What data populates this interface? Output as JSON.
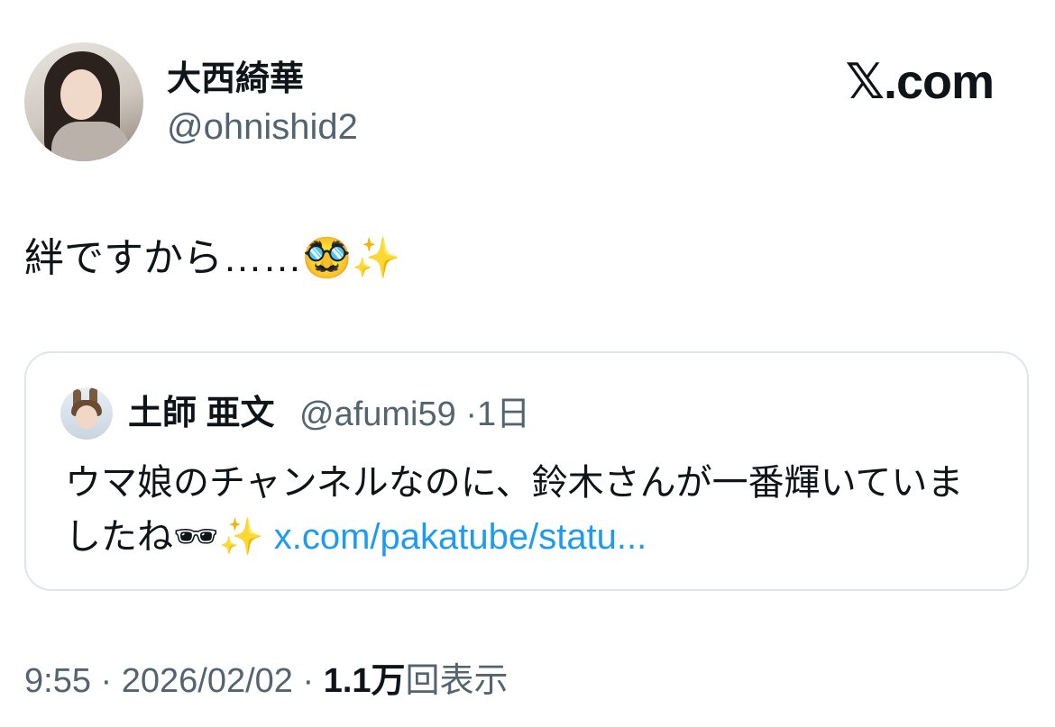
{
  "author": {
    "display_name": "大西綺華",
    "handle": "@ohnishid2"
  },
  "brand": {
    "logo_text": "𝕏.com"
  },
  "tweet": {
    "text": "絆ですから……🥸✨"
  },
  "quoted_tweet": {
    "display_name": "土師 亜文",
    "handle": "@afumi59",
    "separator": "·",
    "age": "1日",
    "text": "ウマ娘のチャンネルなのに、鈴木さんが一番輝いていましたね🕶✨ ",
    "link": "x.com/pakatube/statu..."
  },
  "footer": {
    "time": "9:55",
    "separator1": " · ",
    "date": "2026/02/02",
    "separator2": " · ",
    "views": "1.1万",
    "views_label": "回表示"
  },
  "colors": {
    "text": "#0f1419",
    "secondary": "#536471",
    "link": "#1d9bf0",
    "border": "#dfe5ea"
  }
}
